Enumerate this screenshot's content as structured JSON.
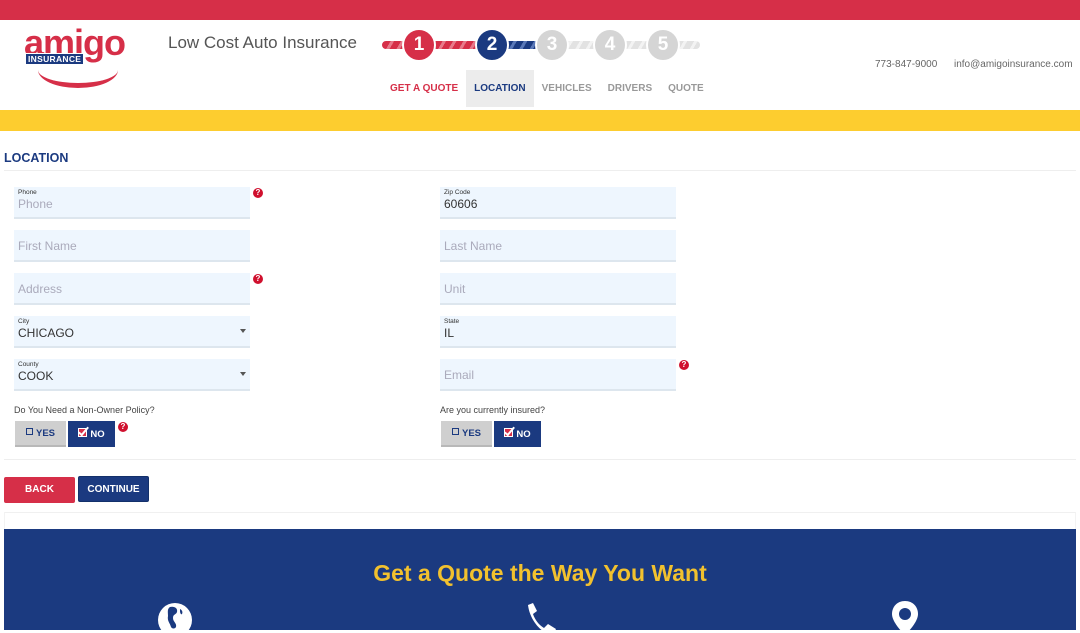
{
  "brand": {
    "logo_word": "amigo",
    "logo_sub": "INSURANCE",
    "tagline": "Low Cost Auto Insurance",
    "colors": {
      "red": "#d62f48",
      "blue": "#1b3a80",
      "yellow": "#fdcd2f",
      "field_bg": "#eef6fe"
    }
  },
  "progress": {
    "current_step": 2,
    "total_steps": 5,
    "steps": [
      {
        "number": "1",
        "state": "done"
      },
      {
        "number": "2",
        "state": "current"
      },
      {
        "number": "3",
        "state": "todo"
      },
      {
        "number": "4",
        "state": "todo"
      },
      {
        "number": "5",
        "state": "todo"
      }
    ]
  },
  "subnav": [
    {
      "label": "GET A QUOTE",
      "state": "done"
    },
    {
      "label": "LOCATION",
      "state": "active"
    },
    {
      "label": "VEHICLES",
      "state": "todo"
    },
    {
      "label": "DRIVERS",
      "state": "todo"
    },
    {
      "label": "QUOTE",
      "state": "todo"
    }
  ],
  "contact": {
    "phone": "773-847-9000",
    "email": "info@amigoinsurance.com"
  },
  "section": {
    "title": "LOCATION"
  },
  "form": {
    "phone": {
      "label": "Phone",
      "placeholder": "Phone",
      "value": ""
    },
    "zip": {
      "label": "Zip Code",
      "value": "60606"
    },
    "first_name": {
      "placeholder": "First Name",
      "value": ""
    },
    "last_name": {
      "placeholder": "Last Name",
      "value": ""
    },
    "address": {
      "placeholder": "Address",
      "value": ""
    },
    "unit": {
      "placeholder": "Unit",
      "value": ""
    },
    "city": {
      "label": "City",
      "value": "CHICAGO"
    },
    "state": {
      "label": "State",
      "value": "IL"
    },
    "county": {
      "label": "County",
      "value": "COOK"
    },
    "email": {
      "placeholder": "Email",
      "value": ""
    },
    "help_glyph": "?",
    "non_owner": {
      "question": "Do You Need a Non-Owner Policy?",
      "yes_label": "YES",
      "no_label": "NO",
      "selected": "NO"
    },
    "insured": {
      "question": "Are you currently insured?",
      "yes_label": "YES",
      "no_label": "NO",
      "selected": "NO"
    }
  },
  "actions": {
    "back_label": "BACK",
    "continue_label": "CONTINUE"
  },
  "cta": {
    "title": "Get a Quote the Way You Want",
    "icons": [
      "globe-icon",
      "phone-icon",
      "map-pin-icon"
    ]
  }
}
